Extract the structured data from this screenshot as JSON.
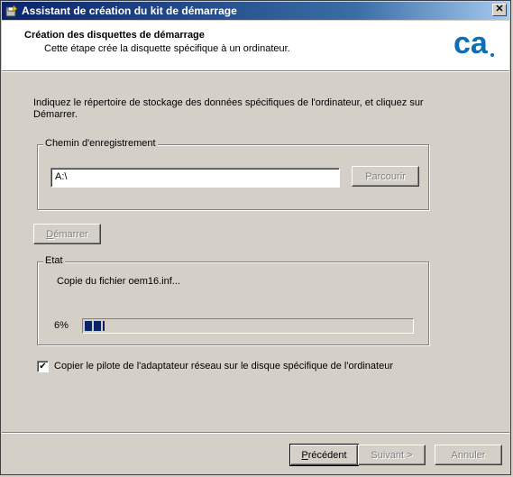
{
  "window": {
    "title": "Assistant de création du kit de démarrage",
    "close_glyph": "✕"
  },
  "header": {
    "title": "Création des disquettes de démarrage",
    "subtitle": "Cette étape crée la disquette spécifique à un ordinateur.",
    "logo_text": "ca",
    "logo_color": "#0b6fb5"
  },
  "instruction": "Indiquez le répertoire de stockage des données spécifiques de l'ordinateur, et cliquez sur Démarrer.",
  "path_group": {
    "label": "Chemin d'enregistrement",
    "path_value": "A:\\",
    "browse_label": "Parcourir"
  },
  "start_button": {
    "label_underlined": "D",
    "label_rest": "émarrer"
  },
  "status_group": {
    "label": "Etat",
    "status_text": "Copie du fichier oem16.inf...",
    "percent_label": "6%",
    "progress_percent": 6
  },
  "copy_driver": {
    "checked": true,
    "check_glyph": "✔",
    "label": "Copier le pilote de l'adaptateur réseau sur le disque spécifique de l'ordinateur"
  },
  "footer": {
    "prev_underlined": "P",
    "prev_rest": "récédent",
    "next_label": "Suivant >",
    "cancel_label": "Annuler"
  }
}
